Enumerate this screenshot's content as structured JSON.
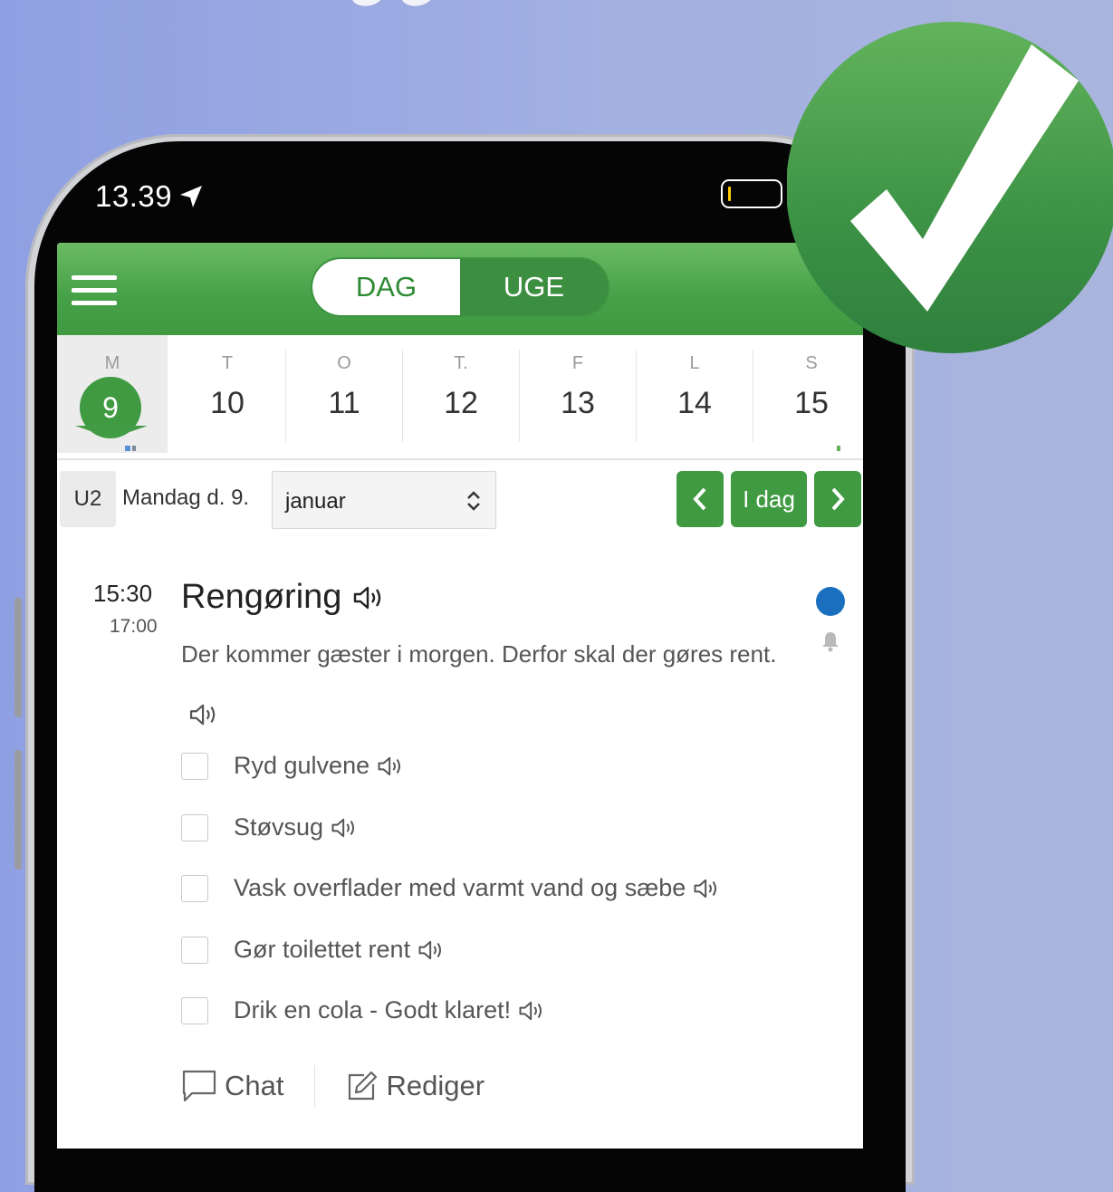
{
  "status_bar": {
    "time": "13.39"
  },
  "app_bar": {
    "seg_day": "DAG",
    "seg_week": "UGE"
  },
  "week": {
    "days": [
      {
        "letter": "M",
        "num": "9"
      },
      {
        "letter": "T",
        "num": "10"
      },
      {
        "letter": "O",
        "num": "11"
      },
      {
        "letter": "T.",
        "num": "12"
      },
      {
        "letter": "F",
        "num": "13"
      },
      {
        "letter": "L",
        "num": "14"
      },
      {
        "letter": "S",
        "num": "15"
      }
    ]
  },
  "date_row": {
    "week_badge": "U2",
    "date_label": "Mandag d. 9.",
    "month": "januar",
    "today_label": "I dag"
  },
  "task": {
    "start": "15:30",
    "end": "17:00",
    "title": "Rengøring",
    "description": "Der kommer gæster i morgen. Derfor skal der gøres rent.",
    "subtasks": [
      "Ryd gulvene",
      "Støvsug",
      "Vask overflader med varmt vand og sæbe",
      "Gør toilettet rent",
      "Drik en cola - Godt klaret!"
    ]
  },
  "actions": {
    "chat": "Chat",
    "edit": "Rediger"
  },
  "colors": {
    "green": "#3f9a42",
    "status_dot": "#1a6fbf",
    "badge_green": "#3a9244"
  },
  "icons": [
    "menu-icon",
    "location-arrow-icon",
    "battery-icon",
    "speaker-icon",
    "bell-icon",
    "chevron-left-icon",
    "chevron-right-icon",
    "chat-bubble-icon",
    "edit-pencil-icon",
    "checkmark-icon"
  ]
}
